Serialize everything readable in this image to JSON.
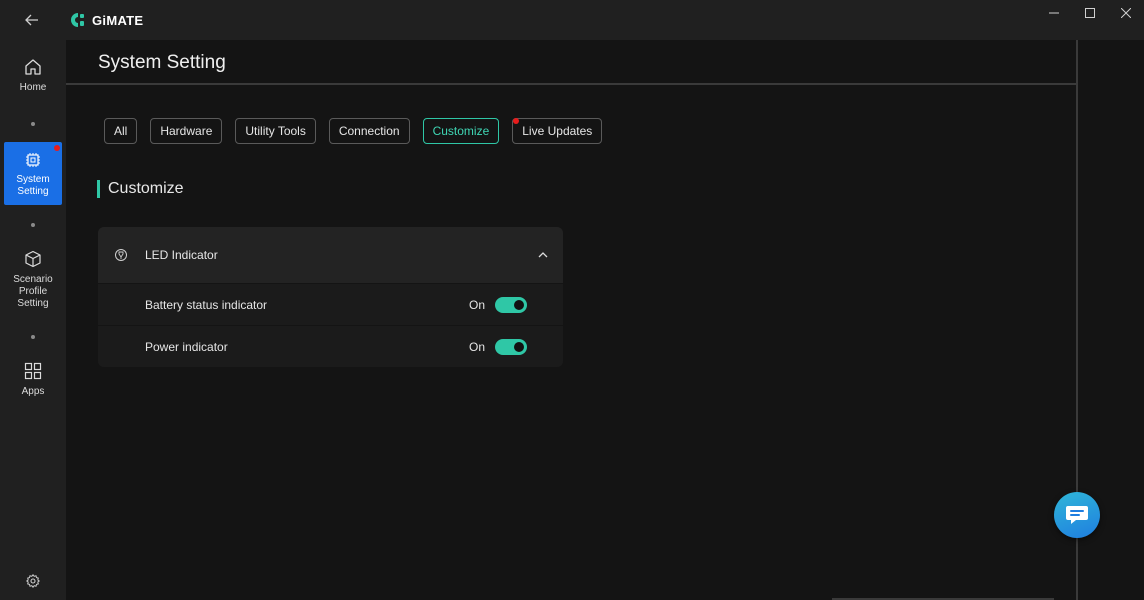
{
  "app": {
    "name": "GiMATE"
  },
  "sidebar": {
    "items": [
      {
        "label": "Home",
        "icon": "home-icon"
      },
      {
        "label": "System\nSetting",
        "icon": "chip-icon",
        "active": true,
        "badge": true
      },
      {
        "label": "Scenario\nProfile\nSetting",
        "icon": "cube-icon"
      },
      {
        "label": "Apps",
        "icon": "grid-icon"
      }
    ],
    "settings_icon": "gear-icon"
  },
  "page": {
    "title": "System Setting"
  },
  "tabs": [
    {
      "label": "All"
    },
    {
      "label": "Hardware"
    },
    {
      "label": "Utility Tools"
    },
    {
      "label": "Connection"
    },
    {
      "label": "Customize",
      "active": true
    },
    {
      "label": "Live Updates",
      "badge": true
    }
  ],
  "section": {
    "title": "Customize"
  },
  "panel": {
    "title": "LED Indicator",
    "icon": "led-icon",
    "expanded": true,
    "rows": [
      {
        "label": "Battery status indicator",
        "state": "On",
        "enabled": true
      },
      {
        "label": "Power indicator",
        "state": "On",
        "enabled": true
      }
    ]
  },
  "colors": {
    "accent": "#2fc7a6",
    "active_nav": "#1a6fe6",
    "badge": "#e81c1c",
    "background": "#141414"
  }
}
